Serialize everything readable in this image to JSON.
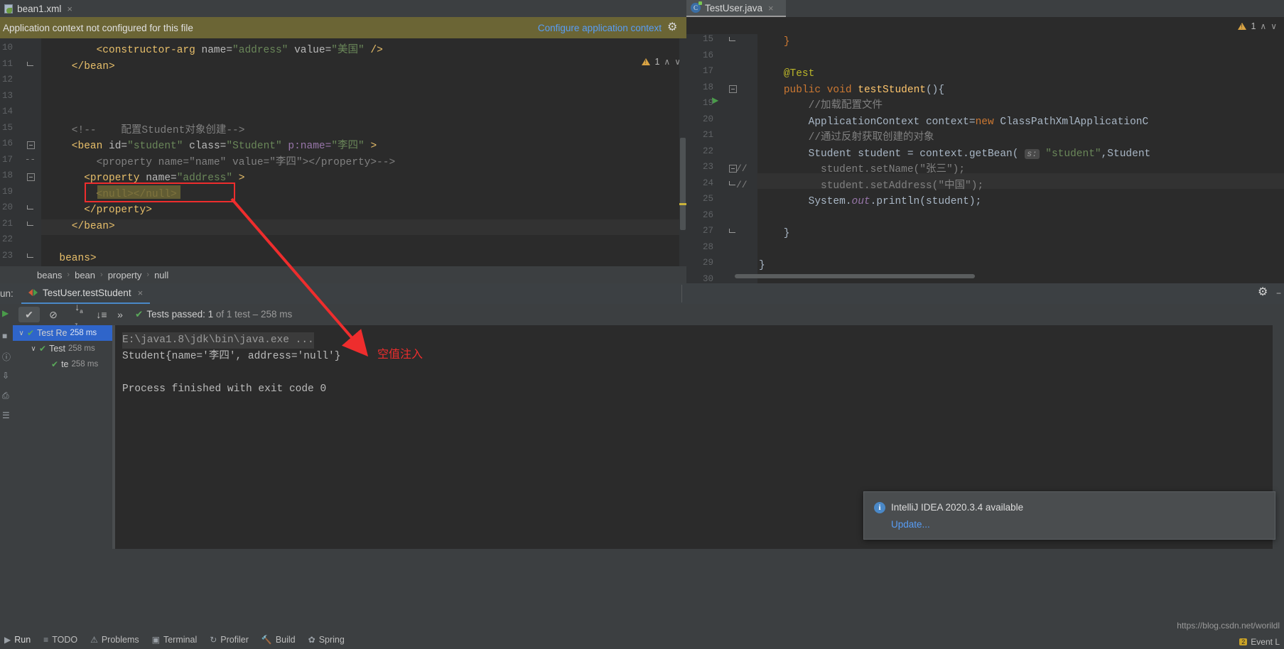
{
  "tabs": [
    {
      "label": "bean1.xml",
      "icon": "xml-file-icon",
      "active": false,
      "close": "×"
    },
    {
      "label": "TestUser.java",
      "icon": "java-class-icon",
      "active": true,
      "close": "×"
    }
  ],
  "context_banner": {
    "message": "Application context not configured for this file",
    "action_label": "Configure application context",
    "gear_icon": "gear-icon",
    "bg_color": "#6b6535"
  },
  "xml_editor": {
    "inspection": {
      "warning_count": "1",
      "up": "∧",
      "down": "∨"
    },
    "lines": [
      {
        "no": "10",
        "indent": 8,
        "html": "<span class='tag'>&lt;constructor-arg</span> <span class='attr'>name=</span><span class='str'>\"address\"</span> <span class='attr'>value=</span><span class='str'>\"美国\"</span> <span class='tag'>/&gt;</span>"
      },
      {
        "no": "11",
        "indent": 4,
        "html": "<span class='tag'>&lt;/bean&gt;</span>"
      },
      {
        "no": "12",
        "indent": 0,
        "html": ""
      },
      {
        "no": "13",
        "indent": 0,
        "html": ""
      },
      {
        "no": "14",
        "indent": 0,
        "html": ""
      },
      {
        "no": "15",
        "indent": 4,
        "html": "<span class='cmt'>&lt;!--    配置Student对象创建--&gt;</span>"
      },
      {
        "no": "16",
        "indent": 4,
        "html": "<span class='tag'>&lt;bean</span> <span class='attr'>id=</span><span class='str'>\"student\"</span> <span class='attr'>class=</span><span class='str'>\"Student\"</span> <span class='attrname'>p:name=</span><span class='str'>\"李四\"</span> <span class='tag'>&gt;</span>"
      },
      {
        "no": "17",
        "indent": 8,
        "html": "<span class='cmt'>&lt;property name=\"name\" value=\"李四\"&gt;&lt;/property&gt;--&gt;</span>"
      },
      {
        "no": "18",
        "indent": 6,
        "html": "<span class='tag'>&lt;property</span> <span class='attr'>name=</span><span class='str'>\"address\"</span> <span class='tag'>&gt;</span>"
      },
      {
        "no": "19",
        "indent": 8,
        "html": "<span class='tag'>&lt;null&gt;&lt;/null&gt;</span>"
      },
      {
        "no": "20",
        "indent": 6,
        "html": "<span class='tag'>&lt;/property&gt;</span>"
      },
      {
        "no": "21",
        "indent": 4,
        "html": "<span class='tag'>&lt;/bean&gt;</span>"
      },
      {
        "no": "22",
        "indent": 0,
        "html": ""
      },
      {
        "no": "23",
        "indent": 2,
        "html": "<span class='tag'>beans&gt;</span>"
      }
    ]
  },
  "breadcrumb": {
    "items": [
      "beans",
      "bean",
      "property",
      "null"
    ],
    "separator": "›"
  },
  "java_editor": {
    "inspection": {
      "warning_count": "1",
      "up": "∧",
      "down": "∨"
    },
    "lines": [
      {
        "no": "15",
        "html": "    <span class='kw'>}</span>"
      },
      {
        "no": "16",
        "html": ""
      },
      {
        "no": "17",
        "html": "    <span class='ann'>@Test</span>"
      },
      {
        "no": "18",
        "html": "    <span class='kw'>public</span> <span class='kw'>void</span> <span style='color:#ffc66d'>testStudent</span>(){"
      },
      {
        "no": "19",
        "html": "        <span class='cmt2'>//加载配置文件</span>"
      },
      {
        "no": "20",
        "html": "        ApplicationContext context=<span class='kw'>new</span> ClassPathXmlApplicationC"
      },
      {
        "no": "21",
        "html": "        <span class='cmt2'>//通过反射获取创建的对象</span>"
      },
      {
        "no": "22",
        "html": "        Student student = context.getBean( <span class='hint'>s:</span> <span class='jstr'>\"student\"</span>,Student"
      },
      {
        "no": "23",
        "html": "          <span class='cmt2'>student.setName(\"张三\");</span>"
      },
      {
        "no": "24",
        "html": "          <span class='cmt2'>student.setAddress(\"中国\");</span>"
      },
      {
        "no": "25",
        "html": "        System.<span class='field'>out</span>.println(student);"
      },
      {
        "no": "26",
        "html": ""
      },
      {
        "no": "27",
        "html": "    }"
      },
      {
        "no": "28",
        "html": ""
      },
      {
        "no": "29",
        "html": "}"
      },
      {
        "no": "30",
        "html": ""
      }
    ]
  },
  "run_window": {
    "label": "un:",
    "tab_label": "TestUser.testStudent",
    "tab_close": "×",
    "settings_icon": "gear-icon",
    "collapse_icon": "−",
    "toolbar": {
      "show_passed_icon": "✔",
      "hide_ignored_icon": "⊘",
      "sort_alpha_icon": "↓",
      "sort_duration_icon": "↓",
      "more_icon": "»"
    },
    "status": {
      "check": "✔",
      "prefix": "Tests passed:",
      "count": "1",
      "of_text": "of 1 test – 258 ms"
    },
    "tree": [
      {
        "label": "Test Re",
        "time": "258 ms",
        "depth": 0,
        "arrow": "∨",
        "selected": true
      },
      {
        "label": "Test",
        "time": "258 ms",
        "depth": 1,
        "arrow": "∨",
        "selected": false
      },
      {
        "label": "te",
        "time": "258 ms",
        "depth": 2,
        "arrow": "",
        "selected": false
      }
    ],
    "console": {
      "command_line": "E:\\java1.8\\jdk\\bin\\java.exe ...",
      "output_line": "Student{name='李四', address='null'}",
      "blank": "",
      "exit_line": "Process finished with exit code 0"
    }
  },
  "annotation": {
    "label": "空值注入",
    "color": "#ee2d2d",
    "box_target": "<null></null>"
  },
  "notification": {
    "icon": "info-icon",
    "title": "IntelliJ IDEA 2020.3.4 available",
    "action": "Update..."
  },
  "tool_buttons": [
    {
      "label": "Run",
      "icon": "▶"
    },
    {
      "label": "TODO",
      "icon": "≡"
    },
    {
      "label": "Problems",
      "icon": "⚠"
    },
    {
      "label": "Terminal",
      "icon": "▣"
    },
    {
      "label": "Profiler",
      "icon": "↻"
    },
    {
      "label": "Build",
      "icon": "🔨"
    },
    {
      "label": "Spring",
      "icon": "✿"
    }
  ],
  "status_bar": {
    "watermark": "https://blog.csdn.net/worildl",
    "event_log": "Event L",
    "event_badge": "2"
  }
}
